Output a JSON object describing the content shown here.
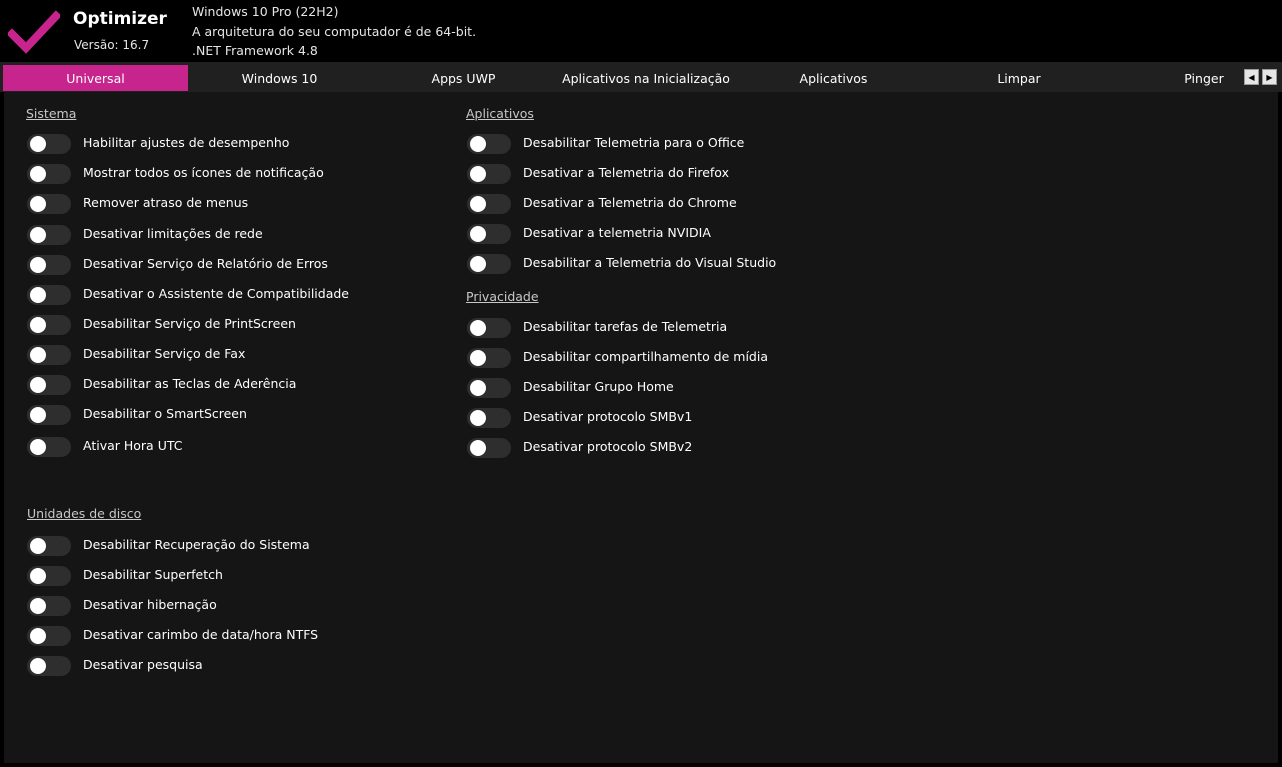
{
  "app": {
    "title": "Optimizer",
    "version": "Versão: 16.7",
    "logo_icon": "checkmark-icon",
    "accent_color": "#c8248e"
  },
  "system_info": {
    "os": "Windows 10 Pro (22H2)",
    "architecture": "A arquitetura do seu computador é de 64-bit.",
    "framework": ".NET Framework 4.8"
  },
  "tabs": [
    {
      "label": "Universal",
      "active": true
    },
    {
      "label": "Windows 10",
      "active": false
    },
    {
      "label": "Apps UWP",
      "active": false
    },
    {
      "label": "Aplicativos na Inicialização",
      "active": false
    },
    {
      "label": "Aplicativos",
      "active": false
    },
    {
      "label": "Limpar",
      "active": false
    },
    {
      "label": "Pinger",
      "active": false
    }
  ],
  "tab_scroll": {
    "left_icon": "arrow-left-icon",
    "right_icon": "arrow-right-icon"
  },
  "sections": {
    "sistema": {
      "title": "Sistema",
      "items": [
        {
          "label": "Habilitar ajustes de desempenho",
          "enabled": false
        },
        {
          "label": "Mostrar todos os ícones de notificação",
          "enabled": false
        },
        {
          "label": "Remover atraso de menus",
          "enabled": false
        },
        {
          "label": "Desativar limitações de rede",
          "enabled": false
        },
        {
          "label": "Desativar Serviço de Relatório de Erros",
          "enabled": false
        },
        {
          "label": "Desativar o Assistente de Compatibilidade",
          "enabled": false
        },
        {
          "label": "Desabilitar Serviço de PrintScreen",
          "enabled": false
        },
        {
          "label": "Desabilitar Serviço de Fax",
          "enabled": false
        },
        {
          "label": "Desabilitar as Teclas de Aderência",
          "enabled": false
        },
        {
          "label": "Desabilitar o SmartScreen",
          "enabled": false
        },
        {
          "label": "Ativar Hora UTC",
          "enabled": false
        }
      ]
    },
    "aplicativos": {
      "title": "Aplicativos",
      "items": [
        {
          "label": "Desabilitar Telemetria para o Office",
          "enabled": false
        },
        {
          "label": "Desativar a Telemetria do Firefox",
          "enabled": false
        },
        {
          "label": "Desativar a Telemetria do Chrome",
          "enabled": false
        },
        {
          "label": "Desativar a telemetria NVIDIA",
          "enabled": false
        },
        {
          "label": "Desabilitar a Telemetria do Visual Studio",
          "enabled": false
        }
      ]
    },
    "privacidade": {
      "title": "Privacidade",
      "items": [
        {
          "label": "Desabilitar tarefas de Telemetria",
          "enabled": false
        },
        {
          "label": "Desabilitar compartilhamento de mídia",
          "enabled": false
        },
        {
          "label": "Desabilitar Grupo Home",
          "enabled": false
        },
        {
          "label": "Desativar protocolo SMBv1",
          "enabled": false
        },
        {
          "label": "Desativar protocolo SMBv2",
          "enabled": false
        }
      ]
    },
    "unidades": {
      "title": "Unidades de disco",
      "items": [
        {
          "label": "Desabilitar Recuperação do Sistema",
          "enabled": false
        },
        {
          "label": "Desabilitar Superfetch",
          "enabled": false
        },
        {
          "label": "Desativar hibernação",
          "enabled": false
        },
        {
          "label": "Desativar carimbo de data/hora NTFS",
          "enabled": false
        },
        {
          "label": "Desativar pesquisa",
          "enabled": false
        }
      ]
    }
  }
}
